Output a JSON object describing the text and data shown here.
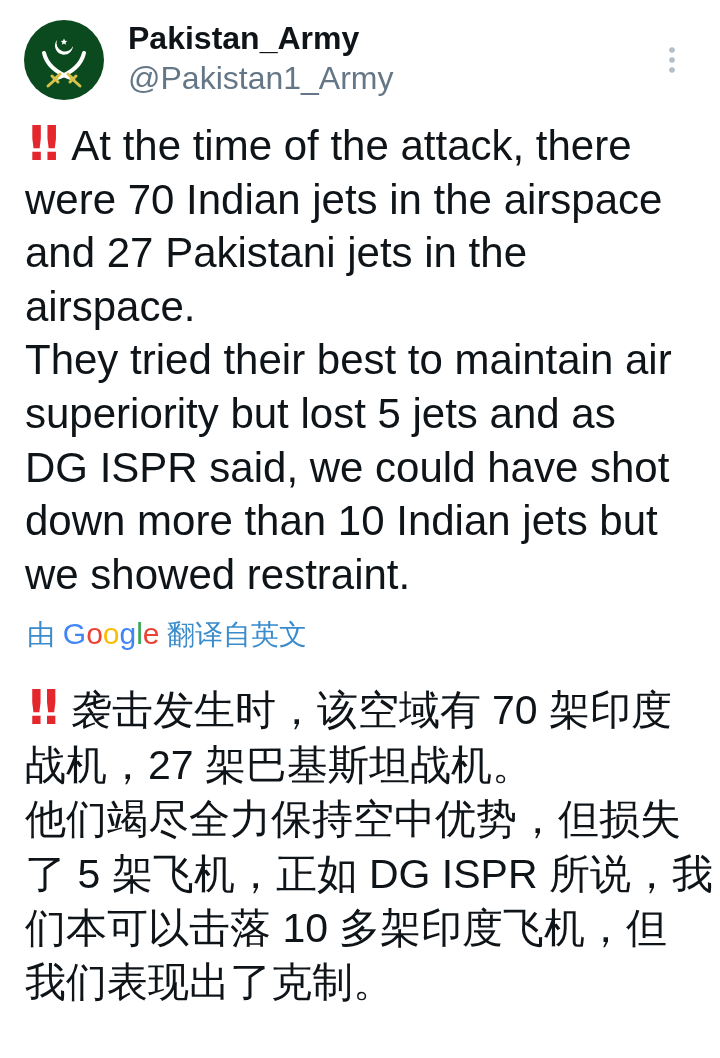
{
  "author": {
    "name": "Pakistan_Army",
    "handle": "@Pakistan1_Army"
  },
  "original_text": {
    "emoji": "‼",
    "lines": [
      "At the time of the attack, there",
      "were 70 Indian jets in the airspace",
      "and 27 Pakistani jets in the",
      "airspace.",
      "They tried their best to maintain air",
      "superiority but lost 5 jets and as",
      "DG ISPR said, we could have shot",
      "down more than 10 Indian jets but",
      "we showed restraint."
    ]
  },
  "translation_notice": {
    "prefix": "由",
    "brand": "Google",
    "suffix": "翻译自英文"
  },
  "translated_text": {
    "emoji": "‼",
    "lines": [
      "袭击发生时，该空域有 70 架印度",
      "战机，27 架巴基斯坦战机。",
      "他们竭尽全力保持空中优势，但损失",
      "了 5 架飞机，正如 DG ISPR 所说，我",
      "们本可以击落 10 多架印度飞机，但",
      "我们表现出了克制。"
    ]
  }
}
